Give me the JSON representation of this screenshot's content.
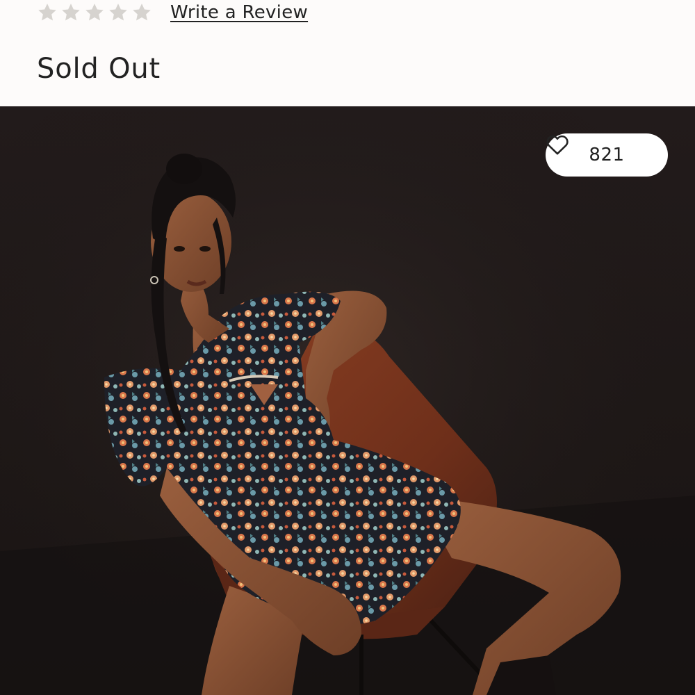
{
  "rating": {
    "stars_filled": 0,
    "stars_total": 5,
    "star_color": "#d6d3cf",
    "write_review_label": "Write a Review"
  },
  "status": {
    "label": "Sold Out"
  },
  "product_image": {
    "alt": "Model seated on a brown leather chair wearing a floral puff-sleeve mini dress",
    "likes": {
      "count": "821",
      "icon": "heart-outline-icon"
    }
  }
}
